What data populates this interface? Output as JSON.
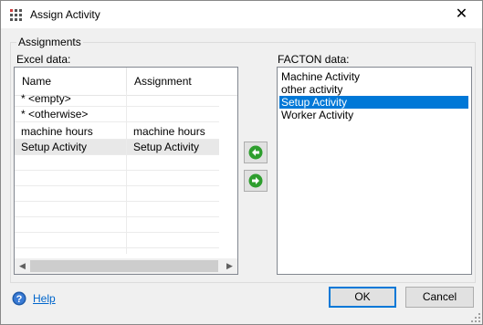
{
  "window": {
    "title": "Assign Activity",
    "close_symbol": "✕"
  },
  "group": {
    "label": "Assignments"
  },
  "excel": {
    "label": "Excel data:",
    "columns": [
      "Name",
      "Assignment"
    ],
    "rows": [
      {
        "name": "* <empty>",
        "assignment": ""
      },
      {
        "name": "* <otherwise>",
        "assignment": ""
      },
      {
        "name": "machine hours",
        "assignment": "machine hours"
      },
      {
        "name": "Setup Activity",
        "assignment": "Setup Activity"
      }
    ]
  },
  "facton": {
    "label": "FACTON data:",
    "items": [
      "Machine Activity",
      "other activity",
      "Setup Activity",
      "Worker Activity"
    ],
    "selected": "Setup Activity"
  },
  "buttons": {
    "help": "Help",
    "ok": "OK",
    "cancel": "Cancel"
  },
  "colors": {
    "selection": "#0078d7",
    "arrow_green": "#2e9e2e",
    "help_blue": "#0066cc"
  }
}
